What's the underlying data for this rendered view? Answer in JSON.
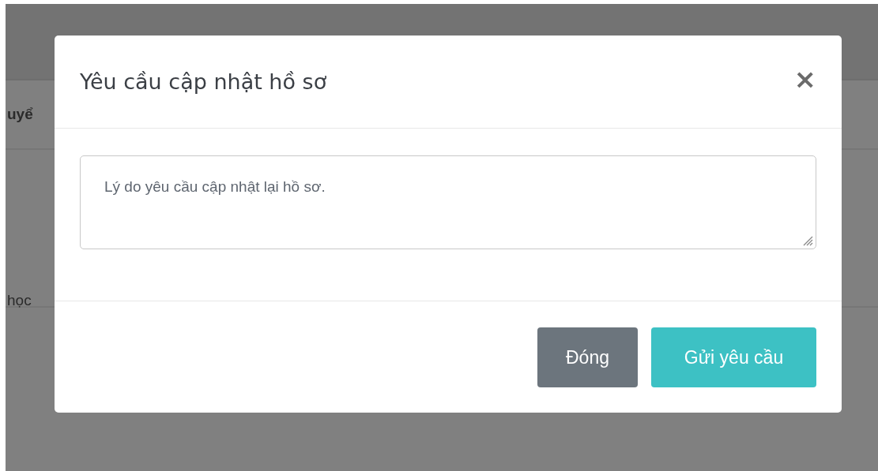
{
  "background": {
    "cells": [
      "uyể",
      "học"
    ]
  },
  "dialog": {
    "title": "Yêu cầu cập nhật hồ sơ",
    "close": "×",
    "reason_field": {
      "placeholder": "Lý do yêu cầu cập nhật lại hồ sơ."
    },
    "buttons": [
      {
        "label": "Đóng",
        "kind": "secondary"
      },
      {
        "label": "Gửi yêu cầu",
        "kind": "primary"
      }
    ]
  }
}
